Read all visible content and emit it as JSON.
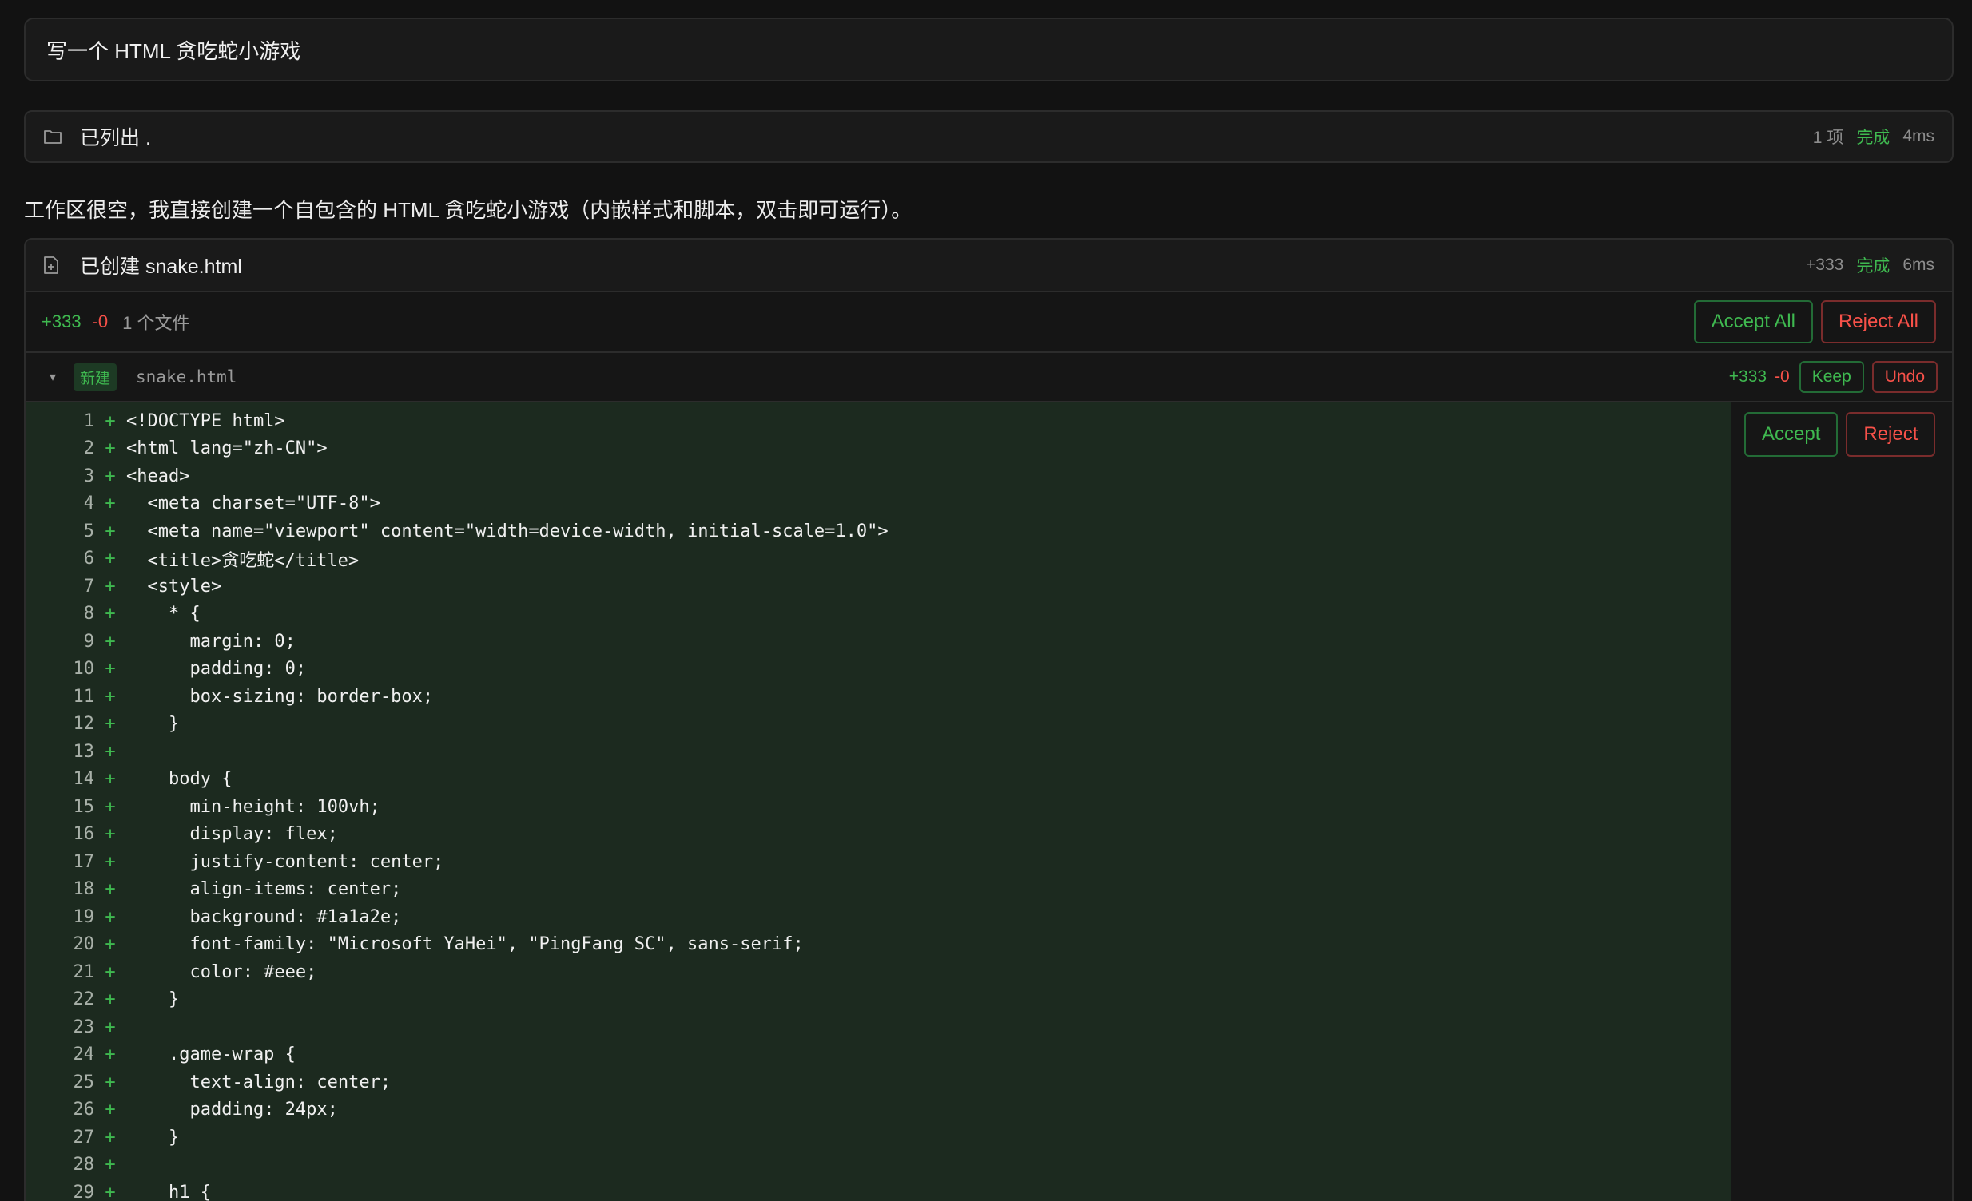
{
  "prompt": {
    "text": "写一个 HTML 贪吃蛇小游戏"
  },
  "list_tool": {
    "title": "已列出 .",
    "count": "1 项",
    "status": "完成",
    "duration": "4ms"
  },
  "assistant_message": "工作区很空，我直接创建一个自包含的 HTML 贪吃蛇小游戏（内嵌样式和脚本，双击即可运行）。",
  "create_tool": {
    "title": "已创建 snake.html",
    "added": "+333",
    "status": "完成",
    "duration": "6ms"
  },
  "summary": {
    "added": "+333",
    "removed": "-0",
    "files": "1 个文件",
    "accept_all": "Accept All",
    "reject_all": "Reject All"
  },
  "file_entry": {
    "badge": "新建",
    "name": "snake.html",
    "added": "+333",
    "removed": "-0",
    "keep": "Keep",
    "undo": "Undo"
  },
  "hunk_actions": {
    "accept": "Accept",
    "reject": "Reject"
  },
  "colors": {
    "added": "#3fb950",
    "removed": "#f85149",
    "diff_bg": "#1c2a1f"
  },
  "icons": {
    "list_tool": "folder-icon",
    "create_tool": "file-plus-icon",
    "collapse": "chevron-down-icon"
  },
  "code_lines": [
    {
      "n": "1",
      "text": "<!DOCTYPE html>"
    },
    {
      "n": "2",
      "text": "<html lang=\"zh-CN\">"
    },
    {
      "n": "3",
      "text": "<head>"
    },
    {
      "n": "4",
      "text": "  <meta charset=\"UTF-8\">"
    },
    {
      "n": "5",
      "text": "  <meta name=\"viewport\" content=\"width=device-width, initial-scale=1.0\">"
    },
    {
      "n": "6",
      "text": "  <title>贪吃蛇</title>"
    },
    {
      "n": "7",
      "text": "  <style>"
    },
    {
      "n": "8",
      "text": "    * {"
    },
    {
      "n": "9",
      "text": "      margin: 0;"
    },
    {
      "n": "10",
      "text": "      padding: 0;"
    },
    {
      "n": "11",
      "text": "      box-sizing: border-box;"
    },
    {
      "n": "12",
      "text": "    }"
    },
    {
      "n": "13",
      "text": ""
    },
    {
      "n": "14",
      "text": "    body {"
    },
    {
      "n": "15",
      "text": "      min-height: 100vh;"
    },
    {
      "n": "16",
      "text": "      display: flex;"
    },
    {
      "n": "17",
      "text": "      justify-content: center;"
    },
    {
      "n": "18",
      "text": "      align-items: center;"
    },
    {
      "n": "19",
      "text": "      background: #1a1a2e;"
    },
    {
      "n": "20",
      "text": "      font-family: \"Microsoft YaHei\", \"PingFang SC\", sans-serif;"
    },
    {
      "n": "21",
      "text": "      color: #eee;"
    },
    {
      "n": "22",
      "text": "    }"
    },
    {
      "n": "23",
      "text": ""
    },
    {
      "n": "24",
      "text": "    .game-wrap {"
    },
    {
      "n": "25",
      "text": "      text-align: center;"
    },
    {
      "n": "26",
      "text": "      padding: 24px;"
    },
    {
      "n": "27",
      "text": "    }"
    },
    {
      "n": "28",
      "text": ""
    },
    {
      "n": "29",
      "text": "    h1 {"
    }
  ]
}
